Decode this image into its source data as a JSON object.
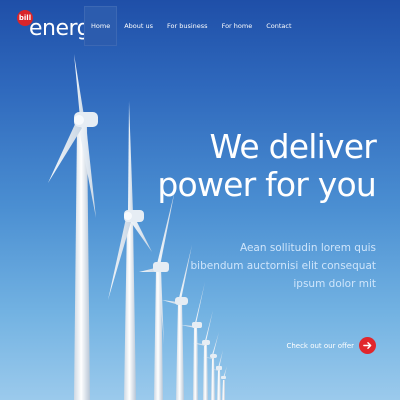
{
  "brand": {
    "badge": "bill",
    "name": "energy",
    "accent_color": "#e1262c"
  },
  "nav": {
    "items": [
      {
        "label": "Home",
        "active": true
      },
      {
        "label": "About us",
        "active": false
      },
      {
        "label": "For business",
        "active": false
      },
      {
        "label": "For home",
        "active": false
      },
      {
        "label": "Contact",
        "active": false
      }
    ]
  },
  "hero": {
    "title_line1": "We deliver",
    "title_line2": "power for you",
    "subtitle_line1": "Aean sollitudin lorem quis",
    "subtitle_line2": "bibendum auctornisi elit consequat",
    "subtitle_line3": "ipsum dolor mit",
    "cta_label": "Check out our offer",
    "cta_icon": "arrow-right-icon",
    "background": "wind-turbines-blue-sky"
  }
}
